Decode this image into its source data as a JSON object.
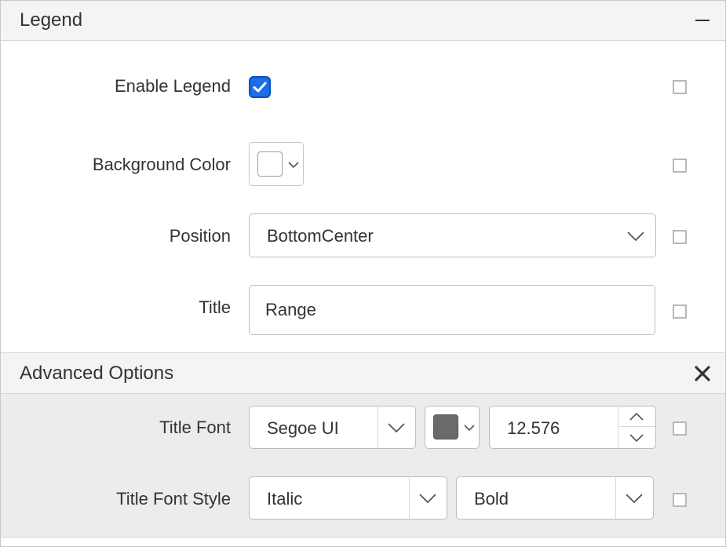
{
  "legend_panel": {
    "title": "Legend",
    "collapse_icon": "minus-icon",
    "fields": {
      "enable_legend": {
        "label": "Enable Legend",
        "checked": true
      },
      "background_color": {
        "label": "Background Color",
        "color": "#ffffff"
      },
      "position": {
        "label": "Position",
        "value": "BottomCenter"
      },
      "title": {
        "label": "Title",
        "value": "Range"
      }
    }
  },
  "advanced_panel": {
    "title": "Advanced Options",
    "close_icon": "close-icon",
    "fields": {
      "title_font": {
        "label": "Title Font",
        "font": "Segoe UI",
        "color": "#6a6a6a",
        "size": "12.576"
      },
      "title_font_style": {
        "label": "Title Font Style",
        "style": "Italic",
        "weight": "Bold"
      }
    }
  },
  "colors": {
    "accent": "#1a6ee8",
    "header_bg": "#f4f4f4",
    "advanced_bg": "#ececec"
  }
}
